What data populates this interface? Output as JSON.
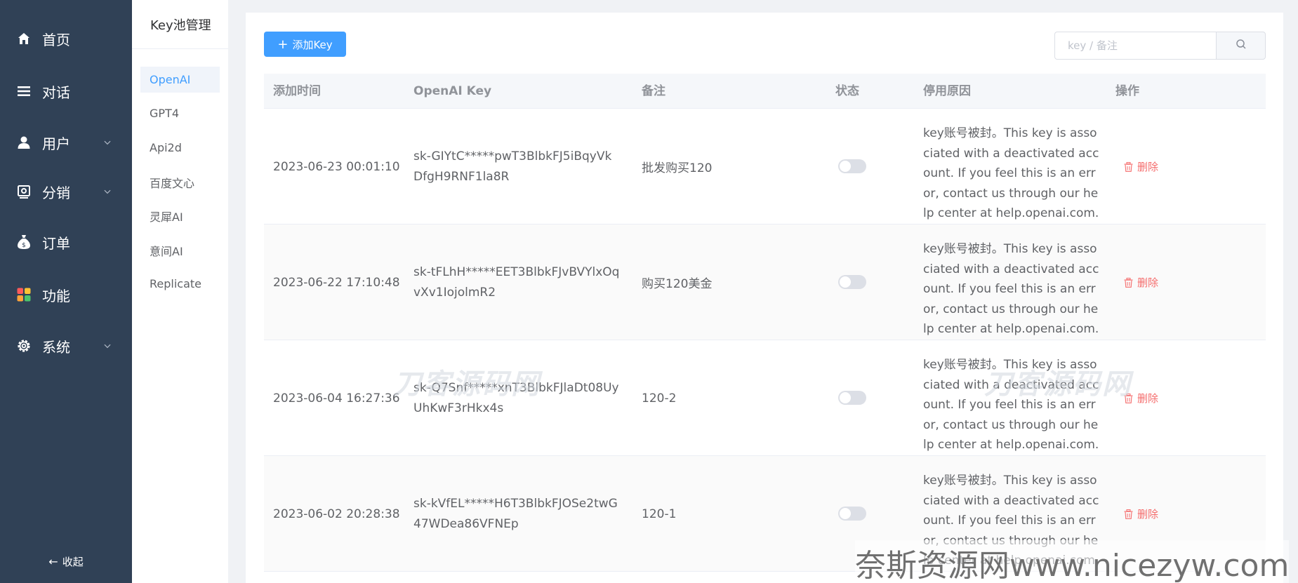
{
  "sidebar": {
    "items": [
      {
        "label": "首页",
        "icon": "home-icon",
        "has_submenu": false
      },
      {
        "label": "对话",
        "icon": "list-icon",
        "has_submenu": false
      },
      {
        "label": "用户",
        "icon": "user-icon",
        "has_submenu": true
      },
      {
        "label": "分销",
        "icon": "distribution-icon",
        "has_submenu": true
      },
      {
        "label": "订单",
        "icon": "money-bag-icon",
        "has_submenu": false
      },
      {
        "label": "功能",
        "icon": "apps-grid-icon",
        "has_submenu": false
      },
      {
        "label": "系统",
        "icon": "gear-icon",
        "has_submenu": true
      }
    ],
    "collapse_label": "收起"
  },
  "submenu": {
    "title": "Key池管理",
    "items": [
      "OpenAI",
      "GPT4",
      "Api2d",
      "百度文心",
      "灵犀AI",
      "意间AI",
      "Replicate"
    ],
    "active": "OpenAI"
  },
  "toolbar": {
    "add_label": "添加Key",
    "search_placeholder": "key / 备注"
  },
  "table": {
    "columns": [
      "添加时间",
      "OpenAI Key",
      "备注",
      "状态",
      "停用原因",
      "操作"
    ],
    "delete_label": "删除",
    "rows": [
      {
        "time": "2023-06-23 00:01:10",
        "key": "sk-GIYtC*****pwT3BlbkFJ5iBqyVkDfgH9RNF1la8R",
        "remark": "批发购买120",
        "enabled": false,
        "reason": "key账号被封。This key is associated with a deactivated account. If you feel this is an error, contact us through our help center at help.openai.com."
      },
      {
        "time": "2023-06-22 17:10:48",
        "key": "sk-tFLhH*****EET3BlbkFJvBVYlxOqvXv1IojolmR2",
        "remark": "购买120美金",
        "enabled": false,
        "reason": "key账号被封。This key is associated with a deactivated account. If you feel this is an error, contact us through our help center at help.openai.com."
      },
      {
        "time": "2023-06-04 16:27:36",
        "key": "sk-Q7Snf*****xnT3BlbkFJlaDt08UyUhKwF3rHkx4s",
        "remark": "120-2",
        "enabled": false,
        "reason": "key账号被封。This key is associated with a deactivated account. If you feel this is an error, contact us through our help center at help.openai.com."
      },
      {
        "time": "2023-06-02 20:28:38",
        "key": "sk-kVfEL*****H6T3BlbkFJOSe2twG47WDea86VFNEp",
        "remark": "120-1",
        "enabled": false,
        "reason": "key账号被封。This key is associated with a deactivated account. If you feel this is an error, contact us through our help center at help.openai.com."
      }
    ]
  },
  "watermarks": {
    "overlay": "刀客源码网",
    "footer": "奈斯资源网www.nicezyw.com"
  },
  "colors": {
    "sidebar_bg": "#304156",
    "primary": "#409eff",
    "danger": "#f56c6c"
  }
}
